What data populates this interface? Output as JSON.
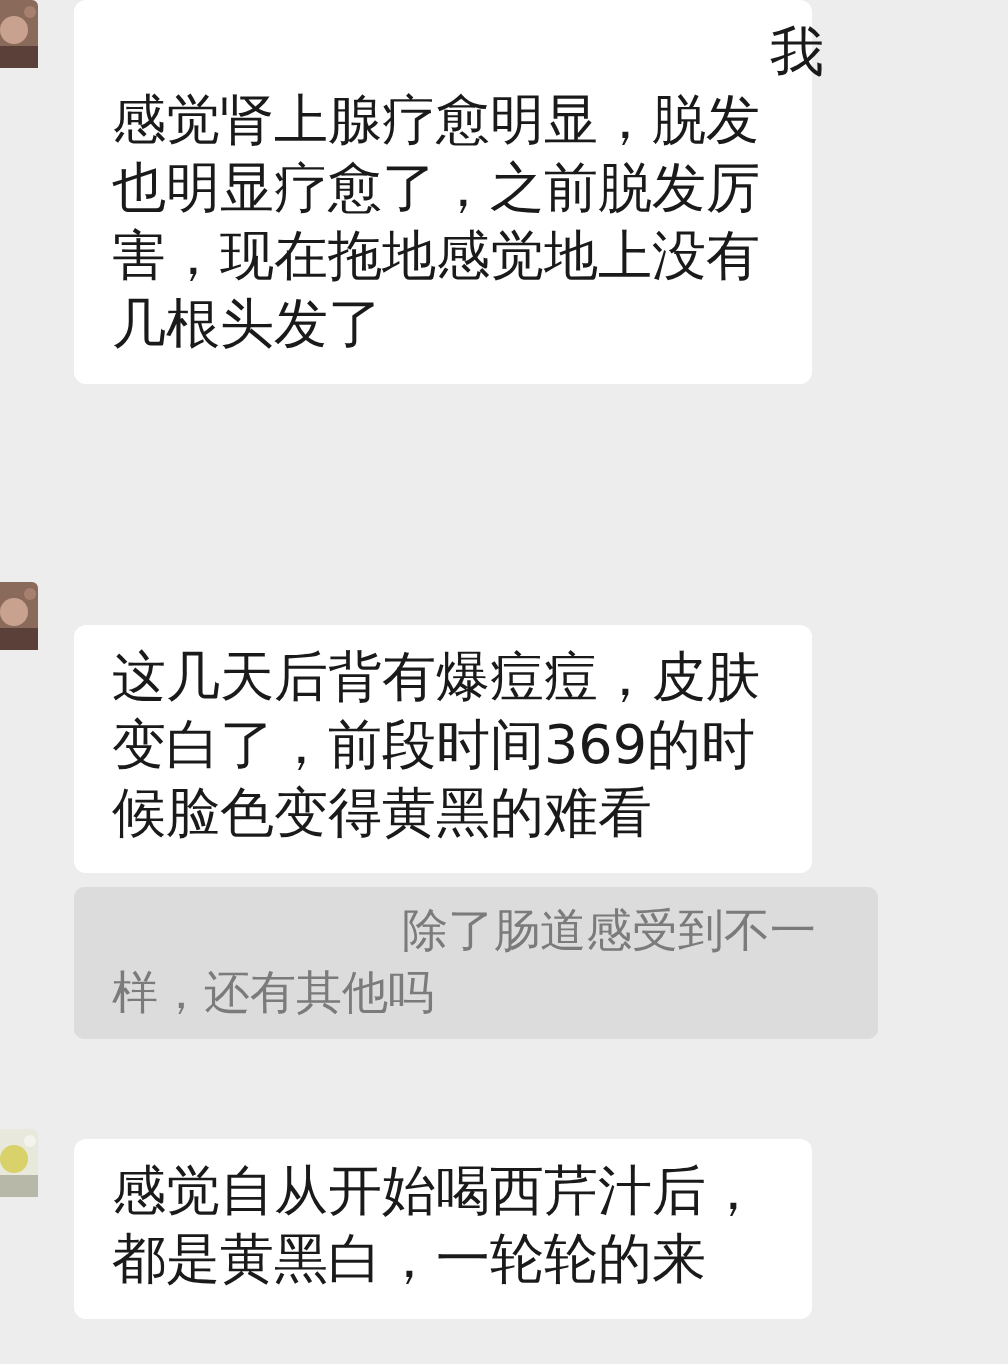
{
  "messages": [
    {
      "kind": "text",
      "avatar": true,
      "lead": "我",
      "text": "感觉肾上腺疗愈明显，脱发也明显疗愈了，之前脱发厉害，现在拖地感觉地上没有几根头发了"
    },
    {
      "kind": "text",
      "avatar": true,
      "text": "这几天后背有爆痘痘，皮肤变白了，前段时间369的时候脸色变得黄黑的难看"
    },
    {
      "kind": "quote",
      "avatar": false,
      "text": "除了肠道感受到不一样，还有其他吗"
    },
    {
      "kind": "text",
      "avatar": true,
      "text": "感觉自从开始喝西芹汁后，都是黄黑白，一轮轮的来"
    }
  ]
}
